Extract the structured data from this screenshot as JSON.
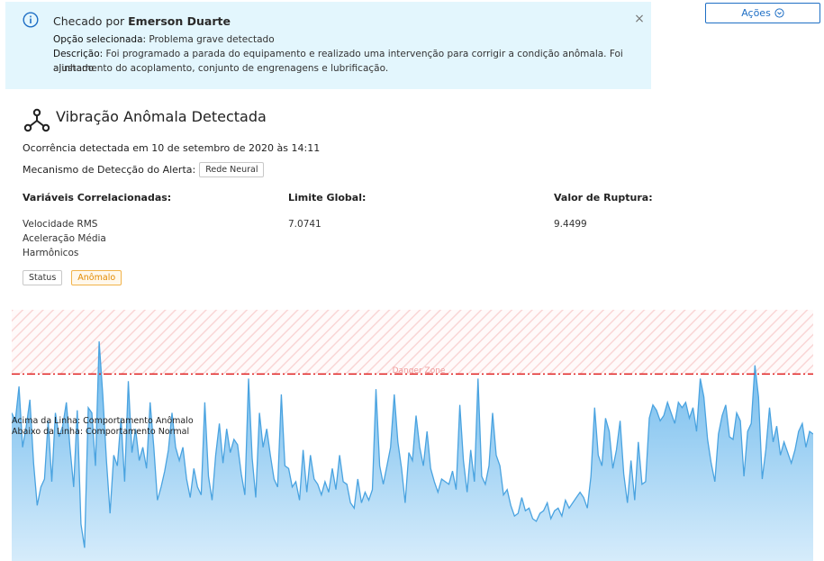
{
  "banner": {
    "checked_prefix": "Checado por",
    "checked_user": "Emerson Duarte",
    "option_label": "Opção selecionada:",
    "option_value": "Problema grave detectado",
    "desc_label": "Descrição:",
    "desc_line1": "Foi programado a parada do equipamento e realizado uma intervenção para corrigir a condição anômala. Foi ajustado",
    "desc_line2": "alinhamento do acoplamento, conjunto de engrenagens e lubrificação.",
    "close_symbol": "×",
    "icon": "info-icon"
  },
  "actions": {
    "label": "Ações",
    "icon": "chevron-down-circle-icon"
  },
  "alert": {
    "icon": "hub-network-icon",
    "title": "Vibração Anômala Detectada",
    "occurrence": "Ocorrência detectada em 10 de setembro de 2020 às 14:11",
    "mechanism_label": "Mecanismo de Detecção do Alerta:",
    "mechanism_value": "Rede Neural"
  },
  "columns": {
    "vars_header": "Variáveis Correlacionadas:",
    "vars": [
      "Velocidade RMS",
      "Aceleração Média",
      "Harmônicos"
    ],
    "limit_header": "Limite Global:",
    "limit_value": "7.0741",
    "rupture_header": "Valor de Ruptura:",
    "rupture_value": "9.4499"
  },
  "status": {
    "label": "Status",
    "value": "Anômalo",
    "value_color": "#e28a00"
  },
  "colors": {
    "accent": "#1f6fc5",
    "banner_bg": "#e3f6fd",
    "threshold": "#e02020",
    "area": "#5aaee6",
    "danger": "#f4a0a0"
  },
  "chart_data": {
    "type": "area",
    "danger_label": "Danger Zone",
    "threshold_above": "Acima da Linha: Comportamento Anômalo",
    "threshold_below": "Abaixo da Linha: Comportamento Normal",
    "threshold": 7.07,
    "ylim": [
      0,
      9.5
    ],
    "values": [
      5.6,
      5.3,
      6.6,
      4.3,
      5.1,
      6.1,
      3.7,
      2.1,
      2.8,
      3.1,
      5.3,
      3.0,
      5.6,
      4.7,
      5.1,
      6.0,
      4.3,
      2.8,
      5.7,
      1.4,
      0.5,
      5.8,
      5.6,
      3.6,
      8.3,
      6.3,
      3.8,
      1.8,
      4.0,
      3.6,
      5.4,
      3.0,
      6.8,
      4.1,
      5.0,
      3.8,
      4.3,
      3.5,
      6.0,
      4.3,
      2.3,
      2.8,
      3.4,
      4.2,
      5.6,
      4.3,
      3.8,
      4.3,
      3.1,
      2.4,
      3.5,
      2.8,
      2.5,
      6.0,
      3.2,
      2.3,
      4.0,
      5.2,
      3.7,
      5.0,
      4.1,
      4.6,
      4.4,
      3.3,
      2.5,
      6.9,
      3.9,
      2.4,
      5.6,
      4.3,
      5.0,
      4.0,
      3.1,
      2.8,
      6.3,
      3.6,
      3.5,
      2.8,
      3.0,
      2.3,
      4.2,
      2.6,
      4.0,
      3.1,
      2.9,
      2.5,
      3.0,
      2.6,
      3.5,
      2.7,
      4.0,
      3.0,
      2.9,
      2.2,
      2.0,
      3.1,
      2.2,
      2.6,
      2.3,
      2.7,
      6.5,
      3.6,
      2.9,
      3.6,
      4.3,
      6.3,
      4.5,
      3.5,
      2.2,
      4.1,
      3.8,
      5.5,
      4.3,
      3.6,
      4.9,
      3.5,
      3.0,
      2.6,
      3.1,
      3.0,
      2.9,
      3.4,
      2.7,
      5.9,
      3.8,
      2.6,
      4.2,
      3.0,
      6.9,
      3.2,
      2.9,
      3.6,
      5.6,
      4.0,
      3.6,
      2.5,
      2.7,
      2.1,
      1.7,
      1.8,
      2.4,
      1.9,
      2.0,
      1.6,
      1.5,
      1.8,
      1.9,
      2.2,
      1.6,
      1.9,
      2.0,
      1.7,
      2.3,
      2.0,
      2.2,
      2.4,
      2.6,
      2.4,
      2.0,
      3.2,
      5.8,
      4.0,
      3.6,
      5.4,
      4.9,
      3.5,
      4.2,
      5.3,
      3.3,
      2.2,
      3.8,
      2.3,
      4.5,
      2.9,
      3.0,
      5.4,
      5.9,
      5.7,
      5.3,
      5.5,
      6.0,
      5.6,
      5.2,
      6.0,
      5.8,
      6.0,
      5.4,
      5.8,
      4.9,
      6.9,
      6.2,
      4.6,
      3.7,
      3.0,
      4.8,
      5.5,
      5.9,
      4.7,
      4.6,
      5.6,
      5.3,
      3.2,
      4.9,
      5.2,
      7.4,
      6.2,
      3.1,
      4.2,
      5.8,
      4.5,
      5.1,
      4.0,
      4.5,
      4.1,
      3.7,
      4.2,
      4.9,
      5.2,
      4.3,
      4.9,
      4.8
    ]
  }
}
